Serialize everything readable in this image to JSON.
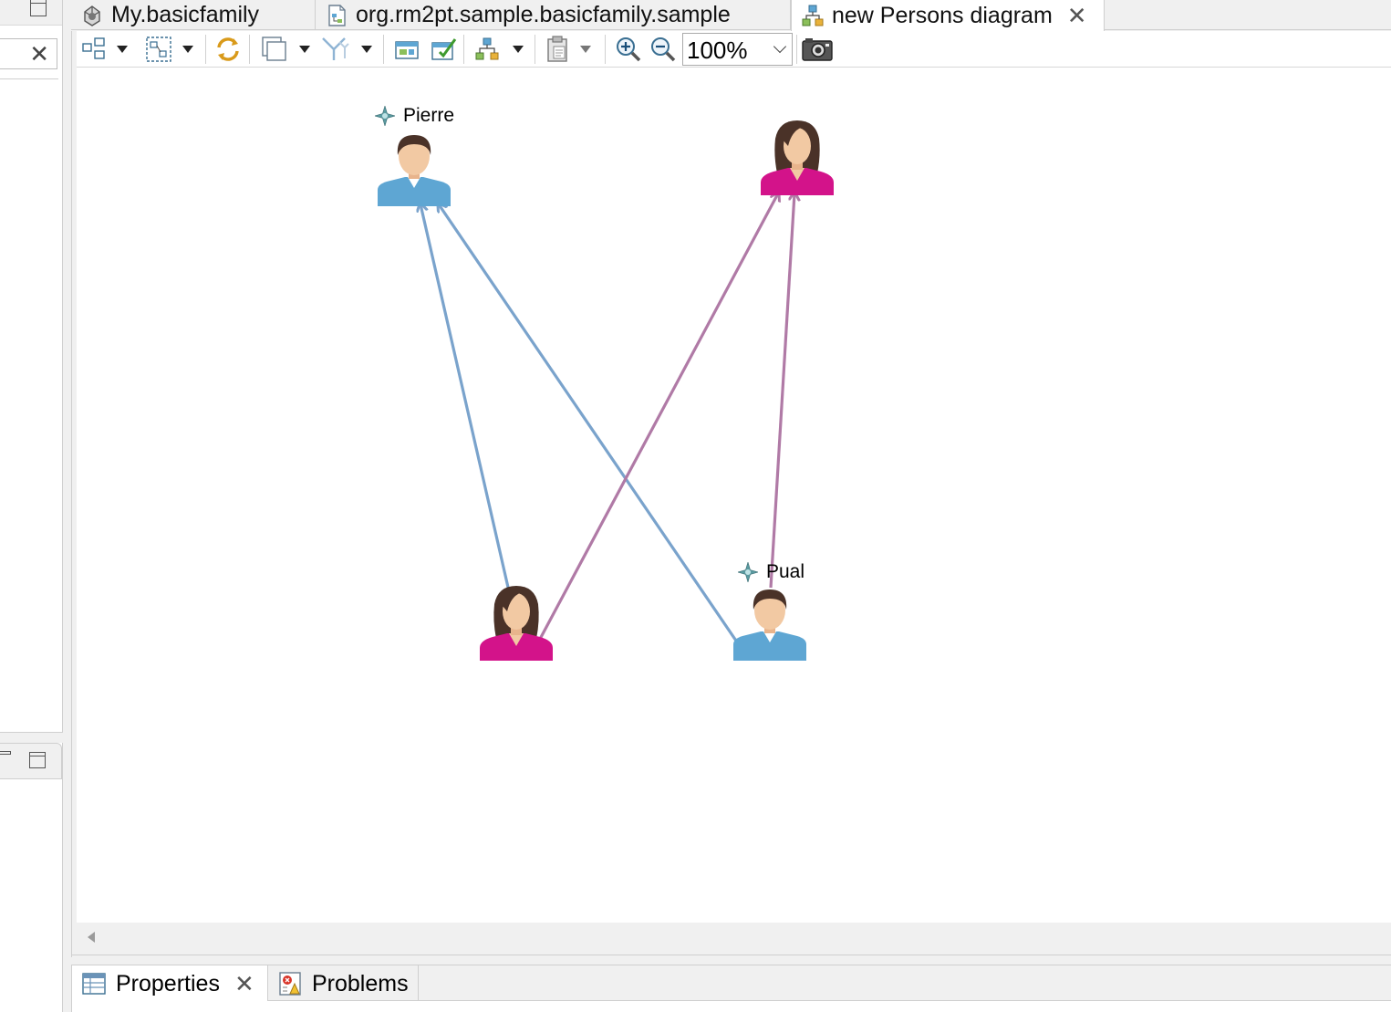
{
  "tabs": [
    {
      "label": "My.basicfamily",
      "icon": "model-icon"
    },
    {
      "label": "org.rm2pt.sample.basicfamily.sample",
      "icon": "representation-file-icon"
    },
    {
      "label": "new Persons diagram",
      "icon": "diagram-icon",
      "active": true
    }
  ],
  "toolbar": {
    "zoom": "100%"
  },
  "diagram": {
    "persons": [
      {
        "name": "Pierre",
        "gender": "male",
        "has_label": true
      },
      {
        "name": "",
        "gender": "female",
        "has_label": false
      },
      {
        "name": "",
        "gender": "female",
        "has_label": false
      },
      {
        "name": "Pual",
        "gender": "male",
        "has_label": true
      }
    ],
    "edges": [
      {
        "kind": "father",
        "color": "#7aa3cc"
      },
      {
        "kind": "father",
        "color": "#7aa3cc"
      },
      {
        "kind": "mother",
        "color": "#b07aa6"
      },
      {
        "kind": "mother",
        "color": "#b07aa6"
      }
    ],
    "colors": {
      "male_shirt": "#5ea6d3",
      "female_shirt": "#d3138a",
      "skin": "#f2c9a3",
      "hair": "#4a3228"
    }
  },
  "bottom_panel": {
    "tabs": [
      {
        "label": "Properties",
        "icon": "properties-icon",
        "active": true
      },
      {
        "label": "Problems",
        "icon": "problems-icon"
      }
    ]
  }
}
